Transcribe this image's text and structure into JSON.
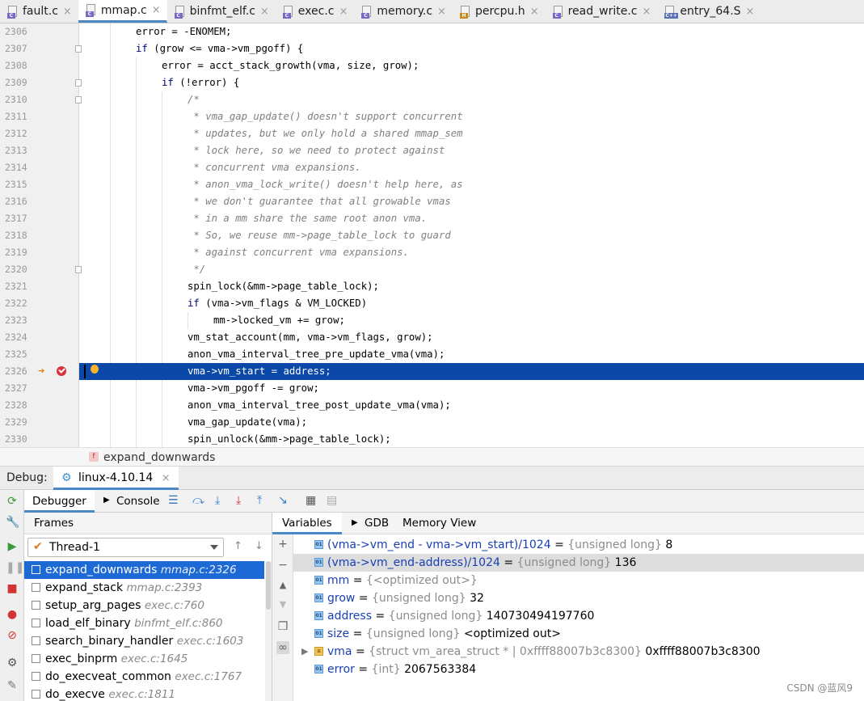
{
  "tabs": [
    {
      "name": "fault.c",
      "badge": "C",
      "kind": "c",
      "active": false
    },
    {
      "name": "mmap.c",
      "badge": "C",
      "kind": "c",
      "active": true
    },
    {
      "name": "binfmt_elf.c",
      "badge": "C",
      "kind": "c",
      "active": false
    },
    {
      "name": "exec.c",
      "badge": "C",
      "kind": "c",
      "active": false
    },
    {
      "name": "memory.c",
      "badge": "C",
      "kind": "c",
      "active": false
    },
    {
      "name": "percpu.h",
      "badge": "H",
      "kind": "h",
      "active": false
    },
    {
      "name": "read_write.c",
      "badge": "C",
      "kind": "c",
      "active": false
    },
    {
      "name": "entry_64.S",
      "badge": "C++",
      "kind": "cpp",
      "active": false
    }
  ],
  "editor": {
    "lines": [
      {
        "num": "2306",
        "indent": 2,
        "segs": [
          {
            "t": "error = -ENOMEM;",
            "k": "plain"
          }
        ]
      },
      {
        "num": "2307",
        "indent": 2,
        "fold": true,
        "segs": [
          {
            "t": "if",
            "k": "kw"
          },
          {
            "t": " (grow <= vma->vm_pgoff) {",
            "k": "plain"
          }
        ]
      },
      {
        "num": "2308",
        "indent": 3,
        "segs": [
          {
            "t": "error = acct_stack_growth(vma, size, grow);",
            "k": "plain"
          }
        ]
      },
      {
        "num": "2309",
        "indent": 3,
        "fold": true,
        "segs": [
          {
            "t": "if",
            "k": "kw"
          },
          {
            "t": " (!error) {",
            "k": "plain"
          }
        ]
      },
      {
        "num": "2310",
        "indent": 4,
        "fold": true,
        "segs": [
          {
            "t": "/*",
            "k": "cmt"
          }
        ]
      },
      {
        "num": "2311",
        "indent": 4,
        "segs": [
          {
            "t": " * vma_gap_update() doesn't support concurrent",
            "k": "cmt"
          }
        ]
      },
      {
        "num": "2312",
        "indent": 4,
        "segs": [
          {
            "t": " * updates, but we only hold a shared mmap_sem",
            "k": "cmt"
          }
        ]
      },
      {
        "num": "2313",
        "indent": 4,
        "segs": [
          {
            "t": " * lock here, so we need to protect against",
            "k": "cmt"
          }
        ]
      },
      {
        "num": "2314",
        "indent": 4,
        "segs": [
          {
            "t": " * concurrent vma expansions.",
            "k": "cmt"
          }
        ]
      },
      {
        "num": "2315",
        "indent": 4,
        "segs": [
          {
            "t": " * anon_vma_lock_write() doesn't help here, as",
            "k": "cmt"
          }
        ]
      },
      {
        "num": "2316",
        "indent": 4,
        "segs": [
          {
            "t": " * we don't guarantee that all growable vmas",
            "k": "cmt"
          }
        ]
      },
      {
        "num": "2317",
        "indent": 4,
        "segs": [
          {
            "t": " * in a mm share the same root anon vma.",
            "k": "cmt"
          }
        ]
      },
      {
        "num": "2318",
        "indent": 4,
        "segs": [
          {
            "t": " * So, we reuse mm->page_table_lock to guard",
            "k": "cmt"
          }
        ]
      },
      {
        "num": "2319",
        "indent": 4,
        "segs": [
          {
            "t": " * against concurrent vma expansions.",
            "k": "cmt"
          }
        ]
      },
      {
        "num": "2320",
        "indent": 4,
        "fold": true,
        "segs": [
          {
            "t": " */",
            "k": "cmt"
          }
        ]
      },
      {
        "num": "2321",
        "indent": 4,
        "segs": [
          {
            "t": "spin_lock(&mm->page_table_lock);",
            "k": "plain"
          }
        ]
      },
      {
        "num": "2322",
        "indent": 4,
        "segs": [
          {
            "t": "if",
            "k": "kw"
          },
          {
            "t": " (vma->vm_flags & VM_LOCKED)",
            "k": "plain"
          }
        ]
      },
      {
        "num": "2323",
        "indent": 5,
        "segs": [
          {
            "t": "mm->locked_vm += grow;",
            "k": "plain"
          }
        ]
      },
      {
        "num": "2324",
        "indent": 4,
        "segs": [
          {
            "t": "vm_stat_account(mm, vma->vm_flags, grow);",
            "k": "plain"
          }
        ]
      },
      {
        "num": "2325",
        "indent": 4,
        "segs": [
          {
            "t": "anon_vma_interval_tree_pre_update_vma(vma);",
            "k": "plain"
          }
        ]
      },
      {
        "num": "2326",
        "indent": 4,
        "current": true,
        "segs": [
          {
            "t": "vma->vm_start = address;",
            "k": "plain"
          }
        ]
      },
      {
        "num": "2327",
        "indent": 4,
        "segs": [
          {
            "t": "vma->vm_pgoff -= grow;",
            "k": "plain"
          }
        ]
      },
      {
        "num": "2328",
        "indent": 4,
        "segs": [
          {
            "t": "anon_vma_interval_tree_post_update_vma(vma);",
            "k": "plain"
          }
        ]
      },
      {
        "num": "2329",
        "indent": 4,
        "segs": [
          {
            "t": "vma_gap_update(vma);",
            "k": "plain"
          }
        ]
      },
      {
        "num": "2330",
        "indent": 4,
        "segs": [
          {
            "t": "spin_unlock(&mm->page_table_lock);",
            "k": "plain"
          }
        ]
      }
    ]
  },
  "breadcrumb": {
    "badge": "f",
    "text": "expand_downwards"
  },
  "debug": {
    "label": "Debug:",
    "run_config": "linux-4.10.14",
    "subtabs": {
      "debugger": "Debugger",
      "console": "Console"
    },
    "frames": {
      "header": "Frames",
      "thread": "Thread-1",
      "items": [
        {
          "fn": "expand_downwards",
          "loc": "mmap.c:2326",
          "selected": true
        },
        {
          "fn": "expand_stack",
          "loc": "mmap.c:2393"
        },
        {
          "fn": "setup_arg_pages",
          "loc": "exec.c:760"
        },
        {
          "fn": "load_elf_binary",
          "loc": "binfmt_elf.c:860"
        },
        {
          "fn": "search_binary_handler",
          "loc": "exec.c:1603"
        },
        {
          "fn": "exec_binprm",
          "loc": "exec.c:1645"
        },
        {
          "fn": "do_execveat_common",
          "loc": "exec.c:1767"
        },
        {
          "fn": "do_execve",
          "loc": "exec.c:1811"
        }
      ]
    },
    "variables": {
      "tabs": {
        "variables": "Variables",
        "gdb": "GDB",
        "memory": "Memory View"
      },
      "items": [
        {
          "name": "(vma->vm_end - vma->vm_start)/1024",
          "eq": " = ",
          "type": "{unsigned long}",
          "value": " 8",
          "icon": "01",
          "kind": "prim"
        },
        {
          "name": "(vma->vm_end-address)/1024",
          "eq": " = ",
          "type": "{unsigned long}",
          "value": " 136",
          "icon": "01",
          "kind": "prim",
          "selected": true
        },
        {
          "name": "mm",
          "eq": " = ",
          "type": "{<optimized out>}",
          "value": "",
          "icon": "01",
          "kind": "prim"
        },
        {
          "name": "grow",
          "eq": " = ",
          "type": "{unsigned long}",
          "value": " 32",
          "icon": "01",
          "kind": "prim"
        },
        {
          "name": "address",
          "eq": " = ",
          "type": "{unsigned long}",
          "value": " 140730494197760",
          "icon": "01",
          "kind": "prim"
        },
        {
          "name": "size",
          "eq": " = ",
          "type": "{unsigned long}",
          "value": " <optimized out>",
          "icon": "01",
          "kind": "prim"
        },
        {
          "name": "vma",
          "eq": " = ",
          "type": "{struct vm_area_struct * | 0xffff88007b3c8300}",
          "value": " 0xffff88007b3c8300",
          "icon": "",
          "kind": "struct",
          "expandable": true
        },
        {
          "name": "error",
          "eq": " = ",
          "type": "{int}",
          "value": " 2067563384",
          "icon": "01",
          "kind": "prim"
        }
      ]
    }
  },
  "watermark": "CSDN @蓝风9",
  "colors": {
    "accent": "#4a88c7",
    "selection": "#1d6ad6",
    "current_line": "#0c48a8"
  }
}
